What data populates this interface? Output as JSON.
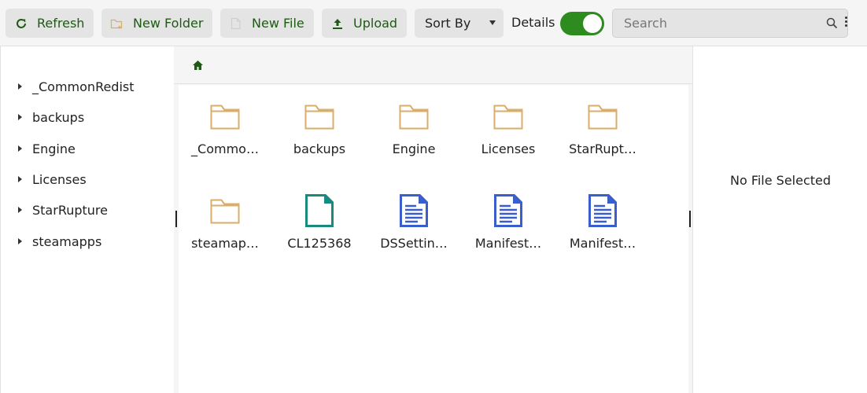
{
  "toolbar": {
    "refresh_label": "Refresh",
    "new_folder_label": "New Folder",
    "new_file_label": "New File",
    "upload_label": "Upload",
    "sort_label": "Sort By",
    "details_label": "Details",
    "details_on": true,
    "search_placeholder": "Search",
    "accent_color": "#1e5a14",
    "toggle_color": "#2e8b1f"
  },
  "sidebar": {
    "items": [
      {
        "label": "_CommonRedist"
      },
      {
        "label": "backups"
      },
      {
        "label": "Engine"
      },
      {
        "label": "Licenses"
      },
      {
        "label": "StarRupture"
      },
      {
        "label": "steamapps"
      }
    ]
  },
  "breadcrumb": {
    "home_icon": "home-icon"
  },
  "files": [
    {
      "name": "_Commo…",
      "icon": "folder-icon"
    },
    {
      "name": "backups",
      "icon": "folder-icon"
    },
    {
      "name": "Engine",
      "icon": "folder-icon"
    },
    {
      "name": "Licenses",
      "icon": "folder-icon"
    },
    {
      "name": "StarRupt…",
      "icon": "folder-icon"
    },
    {
      "name": "steamap…",
      "icon": "folder-icon"
    },
    {
      "name": "CL125368",
      "icon": "file-icon"
    },
    {
      "name": "DSSettin…",
      "icon": "document-icon"
    },
    {
      "name": "Manifest…",
      "icon": "document-icon"
    },
    {
      "name": "Manifest…",
      "icon": "document-icon"
    }
  ],
  "details": {
    "empty_text": "No File Selected"
  },
  "colors": {
    "folder": "#d9ad6a",
    "file": "#1a8a7e",
    "document": "#3a5fcd"
  }
}
